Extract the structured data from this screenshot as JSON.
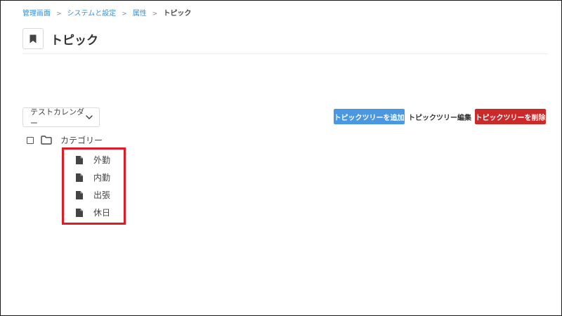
{
  "breadcrumb": {
    "items": [
      "管理画面",
      "システムと設定",
      "属性"
    ],
    "separator": ">",
    "current": "トピック"
  },
  "header": {
    "title": "トピック",
    "icon": "bookmark-icon"
  },
  "calendar": {
    "selected": "テストカレンダー"
  },
  "toolbar": {
    "add_label": "トピックツリーを追加",
    "edit_label": "トピックツリー編集",
    "delete_label": "トピックツリーを削除"
  },
  "tree": {
    "root_label": "カテゴリー",
    "children": [
      "外勤",
      "内勤",
      "出張",
      "休日"
    ]
  },
  "colors": {
    "link": "#3a8fd8",
    "add_button": "#4a98e2",
    "delete_button": "#cc2a2a",
    "highlight": "#e01b24"
  }
}
